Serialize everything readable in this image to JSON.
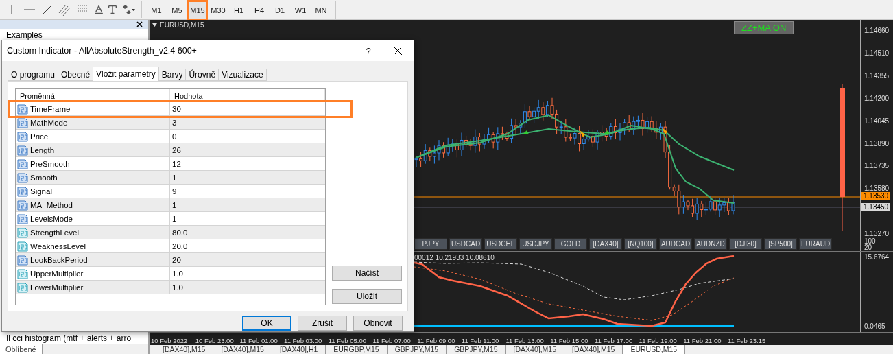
{
  "toolbar": {
    "timeframes": [
      {
        "label": "M1",
        "selected": false
      },
      {
        "label": "M5",
        "selected": false
      },
      {
        "label": "M15",
        "selected": true
      },
      {
        "label": "M30",
        "selected": false
      },
      {
        "label": "H1",
        "selected": false
      },
      {
        "label": "H4",
        "selected": false
      },
      {
        "label": "D1",
        "selected": false
      },
      {
        "label": "W1",
        "selected": false
      },
      {
        "label": "MN",
        "selected": false
      }
    ]
  },
  "navigator": {
    "items": [
      "Examples",
      "Il cci histogram (mtf + alerts + arro"
    ],
    "tabs": [
      {
        "label": "Oblíbené",
        "selected": true
      }
    ]
  },
  "chart": {
    "title": "EURUSD,M15",
    "badge": "ZZ+MA ON",
    "price_ticks": [
      "1.14660",
      "1.14510",
      "1.14355",
      "1.14200",
      "1.14045",
      "1.13890",
      "1.13735",
      "1.13580",
      "1.13270"
    ],
    "price_tags": [
      {
        "label": "1.13530",
        "kind": "line"
      },
      {
        "label": "1.13450",
        "kind": "bid"
      }
    ],
    "symbol_buttons": [
      "PJPY",
      "USDCAD",
      "USDCHF",
      "USDJPY",
      "GOLD",
      "[DAX40]",
      "[NQ100]",
      "AUDCAD",
      "AUDNZD",
      "[DJI30]",
      "[SP500]",
      "EURAUD"
    ],
    "indicator": {
      "values": "00012 10.21933 10.08610",
      "scale": [
        "100",
        "20"
      ],
      "ticks": [
        "15.6764",
        "0.0465"
      ]
    },
    "time_ticks": [
      "10 Feb 2022",
      "10 Feb 23:00",
      "11 Feb 01:00",
      "11 Feb 03:00",
      "11 Feb 05:00",
      "11 Feb 07:00",
      "11 Feb 09:00",
      "11 Feb 11:00",
      "11 Feb 13:00",
      "11 Feb 15:00",
      "11 Feb 17:00",
      "11 Feb 19:00",
      "11 Feb 21:00",
      "11 Feb 23:15"
    ]
  },
  "chart_tabs": [
    {
      "label": "[DAX40],M15",
      "selected": false
    },
    {
      "label": "[DAX40],M15",
      "selected": false
    },
    {
      "label": "[DAX40],H1",
      "selected": false
    },
    {
      "label": "EURGBP,M15",
      "selected": false
    },
    {
      "label": "GBPJPY,M15",
      "selected": false
    },
    {
      "label": "GBPJPY,M15",
      "selected": false
    },
    {
      "label": "[DAX40],M15",
      "selected": false
    },
    {
      "label": "[DAX40],M15",
      "selected": false
    },
    {
      "label": "EURUSD,M15",
      "selected": true
    }
  ],
  "dialog": {
    "title": "Custom Indicator - AllAbsoluteStrength_v2.4 600+",
    "help": "?",
    "tabs": [
      {
        "label": "O programu",
        "selected": false
      },
      {
        "label": "Obecné",
        "selected": false
      },
      {
        "label": "Vložit parametry",
        "selected": true
      },
      {
        "label": "Barvy",
        "selected": false
      },
      {
        "label": "Úrovně",
        "selected": false
      },
      {
        "label": "Vizualizace",
        "selected": false
      }
    ],
    "columns": [
      "Proměnná",
      "Hodnota"
    ],
    "rows": [
      {
        "name": "TimeFrame",
        "value": "30",
        "kind": "integer",
        "highlighted": true
      },
      {
        "name": "MathMode",
        "value": "3",
        "kind": "integer",
        "highlighted": false
      },
      {
        "name": "Price",
        "value": "0",
        "kind": "integer",
        "highlighted": false
      },
      {
        "name": "Length",
        "value": "26",
        "kind": "integer",
        "highlighted": false
      },
      {
        "name": "PreSmooth",
        "value": "12",
        "kind": "integer",
        "highlighted": false
      },
      {
        "name": "Smooth",
        "value": "1",
        "kind": "integer",
        "highlighted": false
      },
      {
        "name": "Signal",
        "value": "9",
        "kind": "integer",
        "highlighted": false
      },
      {
        "name": "MA_Method",
        "value": "1",
        "kind": "integer",
        "highlighted": false
      },
      {
        "name": "LevelsMode",
        "value": "1",
        "kind": "integer",
        "highlighted": false
      },
      {
        "name": "StrengthLevel",
        "value": "80.0",
        "kind": "decimal",
        "highlighted": false
      },
      {
        "name": "WeaknessLevel",
        "value": "20.0",
        "kind": "decimal",
        "highlighted": false
      },
      {
        "name": "LookBackPeriod",
        "value": "20",
        "kind": "integer",
        "highlighted": false
      },
      {
        "name": "UpperMultiplier",
        "value": "1.0",
        "kind": "decimal",
        "highlighted": false
      },
      {
        "name": "LowerMultiplier",
        "value": "1.0",
        "kind": "decimal",
        "highlighted": false
      }
    ],
    "side_buttons": [
      "Načíst",
      "Uložit"
    ],
    "buttons": [
      {
        "label": "OK",
        "default": true
      },
      {
        "label": "Zrušit",
        "default": false
      },
      {
        "label": "Obnovit",
        "default": false
      }
    ]
  }
}
